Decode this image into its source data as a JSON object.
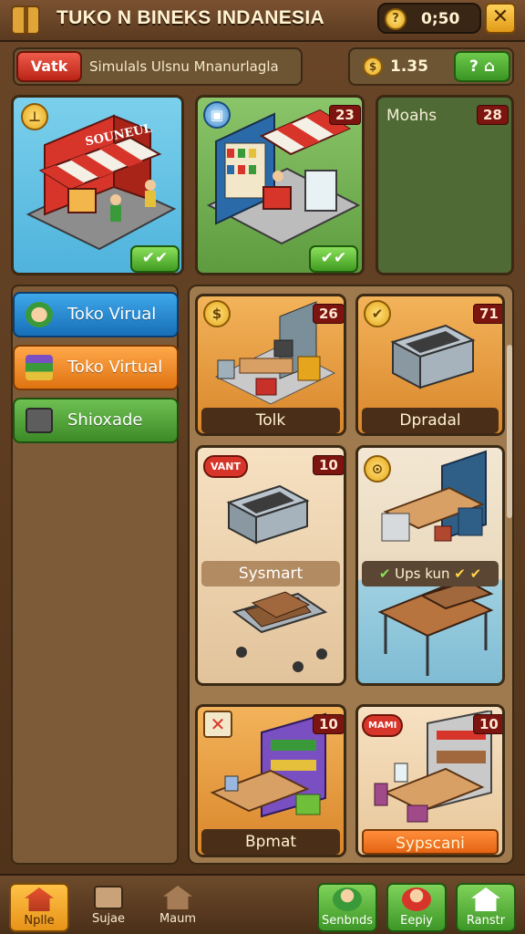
{
  "header": {
    "title": "TUKO N BINEKS INDANESIA",
    "coins_value": "0;50",
    "coin_glyph": "?",
    "close_glyph": "✕",
    "box_icon": "crate-icon"
  },
  "topbar": {
    "red_button_label": "Vatk",
    "subtitle": "Simulals Ulsnu Mnanurlagla",
    "money_value": "1.35",
    "money_coin_glyph": "$",
    "green_button_label": "?"
  },
  "cards": [
    {
      "id": "c1",
      "sign": "SOUNEUL",
      "check": "✔✔",
      "icon": "pin-icon"
    },
    {
      "id": "c2",
      "badge": "23",
      "check": "✔✔",
      "icon": "bucket-icon"
    },
    {
      "id": "c3",
      "label": "Moahs",
      "badge": "28"
    }
  ],
  "sidebar": {
    "items": [
      {
        "label": "Toko Virual",
        "icon": "shopkeeper-icon"
      },
      {
        "label": "Toko Virtual",
        "icon": "stack-icon"
      },
      {
        "label": "Shioxade",
        "icon": "safe-icon"
      }
    ]
  },
  "tiles": [
    {
      "name": "Tolk",
      "badge": "26",
      "icon_glyph": "$"
    },
    {
      "name": "Dpradal",
      "badge": "71",
      "icon_glyph": "✔"
    },
    {
      "name": "Sysmart",
      "badge": "10",
      "tag": "VANT"
    },
    {
      "name": "Ups kun",
      "icon_glyph": "⊙",
      "check_left": "✔",
      "check_right": "✔ ✔"
    },
    {
      "name": "Bpmat",
      "badge": "10",
      "icon_glyph": "✕"
    },
    {
      "name": "Sypscani",
      "badge": "10",
      "tag": "MAMI"
    }
  ],
  "bottom_nav": [
    {
      "label": "Nplle",
      "icon": "home-icon"
    },
    {
      "label": "Sujae",
      "icon": "doors-icon"
    },
    {
      "label": "Maum",
      "icon": "house-icon"
    },
    {
      "label": "Senbnds",
      "icon": "person-icon"
    },
    {
      "label": "Eepiy",
      "icon": "person-red-icon"
    },
    {
      "label": "Ranstr",
      "icon": "home-arrow-icon"
    }
  ],
  "colors": {
    "wood": "#6b4628",
    "accent_orange": "#e79318",
    "accent_green": "#3d9626",
    "accent_red": "#b92416",
    "accent_blue": "#176fb8"
  }
}
